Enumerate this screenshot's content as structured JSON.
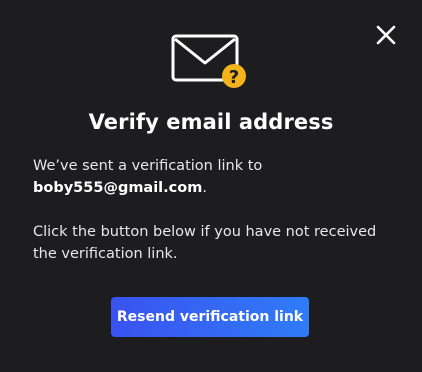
{
  "modal": {
    "title": "Verify email address",
    "intro_text": "We’ve sent a verification link to",
    "email": "boby555@gmail.com",
    "email_suffix": ".",
    "help_text": "Click the button below if you have not received the verification link.",
    "resend_label": "Resend verification link",
    "icons": {
      "close": "close-icon",
      "mail": "mail-question-icon"
    },
    "colors": {
      "background": "#1d1d1f",
      "text": "#ffffff",
      "button_start": "#3a52f0",
      "button_end": "#2f7cf7",
      "badge": "#f2b31b"
    }
  }
}
